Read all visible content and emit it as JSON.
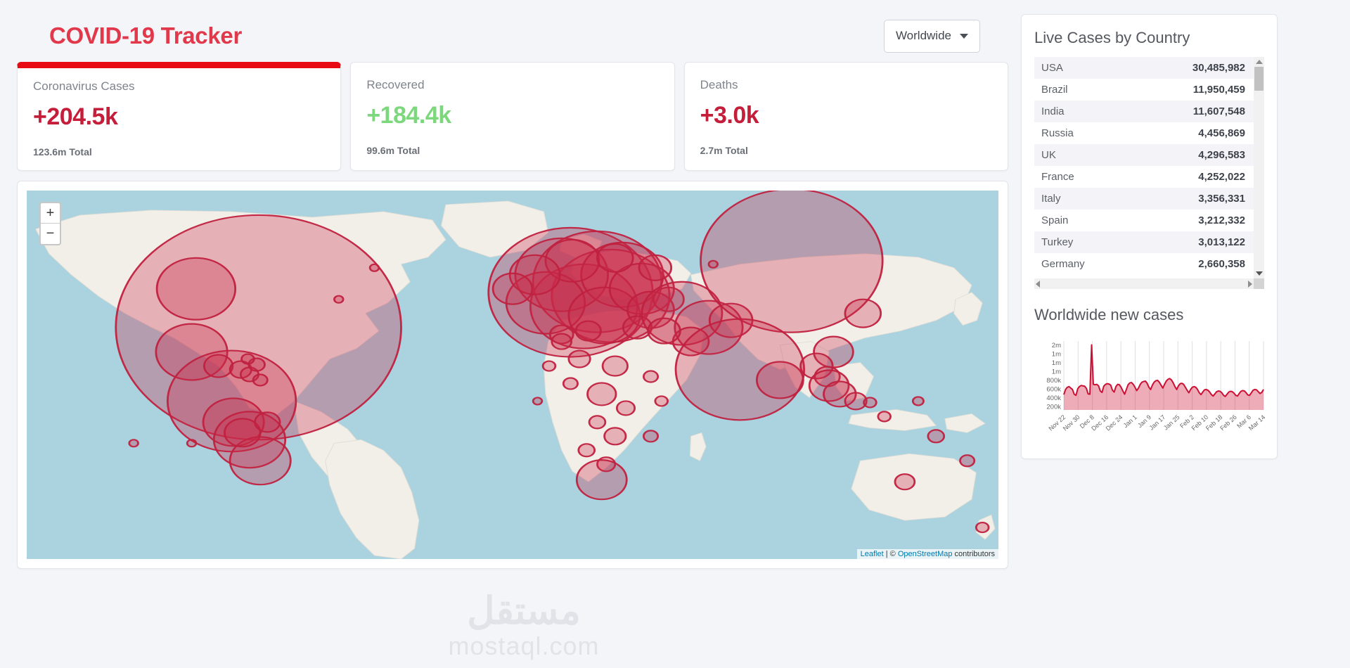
{
  "header": {
    "title": "COVID-19 Tracker",
    "dropdown": {
      "label": "Worldwide",
      "icon": "chevron-down-icon"
    }
  },
  "stats": [
    {
      "title": "Coronavirus Cases",
      "value": "+204.5k",
      "total": "123.6m Total",
      "color": "#c41e3a",
      "selected": true
    },
    {
      "title": "Recovered",
      "value": "+184.4k",
      "total": "99.6m Total",
      "color": "#7dd87d",
      "selected": false
    },
    {
      "title": "Deaths",
      "value": "+3.0k",
      "total": "2.7m Total",
      "color": "#c41e3a",
      "selected": false
    }
  ],
  "map": {
    "zoom_in": "+",
    "zoom_out": "−",
    "attribution": {
      "leaflet": "Leaflet",
      "separator": " | ",
      "copyright": "© ",
      "osm": "OpenStreetMap",
      "contributors": " contributors"
    },
    "ocean_color": "#aad3df",
    "land_color": "#f2efe9",
    "circle_color": "#cb2d4b"
  },
  "sidebar": {
    "cases_panel_title": "Live Cases by Country",
    "countries": [
      {
        "name": "USA",
        "cases": "30,485,982"
      },
      {
        "name": "Brazil",
        "cases": "11,950,459"
      },
      {
        "name": "India",
        "cases": "11,607,548"
      },
      {
        "name": "Russia",
        "cases": "4,456,869"
      },
      {
        "name": "UK",
        "cases": "4,296,583"
      },
      {
        "name": "France",
        "cases": "4,252,022"
      },
      {
        "name": "Italy",
        "cases": "3,356,331"
      },
      {
        "name": "Spain",
        "cases": "3,212,332"
      },
      {
        "name": "Turkey",
        "cases": "3,013,122"
      },
      {
        "name": "Germany",
        "cases": "2,660,358"
      }
    ],
    "chart_panel_title": "Worldwide new cases"
  },
  "watermark": {
    "arabic": "مستقل",
    "latin": "mostaql.com"
  },
  "chart_data": {
    "type": "area",
    "title": "Worldwide new cases",
    "xlabel": "",
    "ylabel": "",
    "grid": true,
    "legend": "none",
    "line_color": "#cc1034",
    "fill_color": "rgba(204,16,52,0.35)",
    "ylim": [
      200000,
      2000000
    ],
    "ytick_labels": [
      "2m",
      "1m",
      "1m",
      "1m",
      "800k",
      "600k",
      "400k",
      "200k"
    ],
    "ytick_values": [
      2000000,
      1800000,
      1600000,
      1400000,
      800000,
      600000,
      400000,
      200000
    ],
    "xtick_labels": [
      "Nov 22",
      "Nov 30",
      "Dec 8",
      "Dec 16",
      "Dec 24",
      "Jan 1",
      "Jan 9",
      "Jan 17",
      "Jan 25",
      "Feb 2",
      "Feb 10",
      "Feb 18",
      "Feb 26",
      "Mar 6",
      "Mar 14"
    ],
    "x": [
      "Nov 22",
      "Nov 23",
      "Nov 24",
      "Nov 25",
      "Nov 26",
      "Nov 27",
      "Nov 28",
      "Nov 29",
      "Nov 30",
      "Dec 1",
      "Dec 2",
      "Dec 3",
      "Dec 4",
      "Dec 5",
      "Dec 6",
      "Dec 7",
      "Dec 8",
      "Dec 9",
      "Dec 10",
      "Dec 11",
      "Dec 12",
      "Dec 13",
      "Dec 14",
      "Dec 15",
      "Dec 16",
      "Dec 17",
      "Dec 18",
      "Dec 19",
      "Dec 20",
      "Dec 21",
      "Dec 22",
      "Dec 23",
      "Dec 24",
      "Dec 25",
      "Dec 26",
      "Dec 27",
      "Dec 28",
      "Dec 29",
      "Dec 30",
      "Dec 31",
      "Jan 1",
      "Jan 2",
      "Jan 3",
      "Jan 4",
      "Jan 5",
      "Jan 6",
      "Jan 7",
      "Jan 8",
      "Jan 9",
      "Jan 10",
      "Jan 11",
      "Jan 12",
      "Jan 13",
      "Jan 14",
      "Jan 15",
      "Jan 16",
      "Jan 17",
      "Jan 18",
      "Jan 19",
      "Jan 20",
      "Jan 21",
      "Jan 22",
      "Jan 23",
      "Jan 24",
      "Jan 25",
      "Jan 26",
      "Jan 27",
      "Jan 28",
      "Jan 29",
      "Jan 30",
      "Jan 31",
      "Feb 1",
      "Feb 2",
      "Feb 3",
      "Feb 4",
      "Feb 5",
      "Feb 6",
      "Feb 7",
      "Feb 8",
      "Feb 9",
      "Feb 10",
      "Feb 11",
      "Feb 12",
      "Feb 13",
      "Feb 14",
      "Feb 15",
      "Feb 16",
      "Feb 17",
      "Feb 18",
      "Feb 19",
      "Feb 20",
      "Feb 21",
      "Feb 22",
      "Feb 23",
      "Feb 24",
      "Feb 25",
      "Feb 26",
      "Feb 27",
      "Feb 28",
      "Mar 1",
      "Mar 2",
      "Mar 3",
      "Mar 4",
      "Mar 5",
      "Mar 6",
      "Mar 7",
      "Mar 8",
      "Mar 9",
      "Mar 10",
      "Mar 11",
      "Mar 12",
      "Mar 13",
      "Mar 14",
      "Mar 15",
      "Mar 16",
      "Mar 17"
    ],
    "values": [
      420000,
      560000,
      620000,
      640000,
      600000,
      560000,
      430000,
      400000,
      580000,
      640000,
      670000,
      660000,
      650000,
      590000,
      440000,
      430000,
      1780000,
      700000,
      690000,
      700000,
      660000,
      520000,
      480000,
      650000,
      700000,
      720000,
      710000,
      680000,
      540000,
      490000,
      640000,
      700000,
      690000,
      620000,
      520000,
      430000,
      560000,
      690000,
      740000,
      750000,
      700000,
      620000,
      530000,
      600000,
      700000,
      760000,
      780000,
      790000,
      730000,
      620000,
      560000,
      680000,
      760000,
      800000,
      810000,
      760000,
      680000,
      600000,
      700000,
      790000,
      840000,
      860000,
      820000,
      740000,
      640000,
      560000,
      660000,
      720000,
      730000,
      700000,
      620000,
      540000,
      470000,
      560000,
      620000,
      640000,
      620000,
      560000,
      470000,
      420000,
      490000,
      550000,
      560000,
      540000,
      490000,
      420000,
      380000,
      440000,
      500000,
      520000,
      510000,
      470000,
      400000,
      370000,
      430000,
      490000,
      510000,
      500000,
      460000,
      400000,
      380000,
      450000,
      510000,
      530000,
      520000,
      470000,
      410000,
      400000,
      470000,
      540000,
      560000,
      550000,
      500000,
      450000,
      480000,
      560000
    ]
  }
}
